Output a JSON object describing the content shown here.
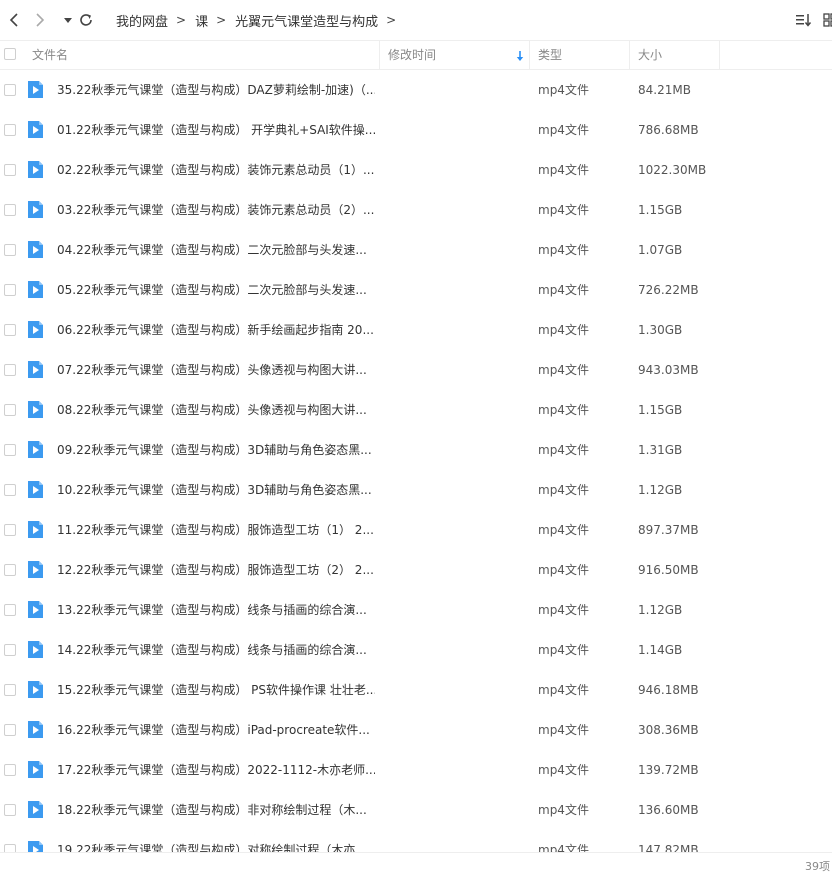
{
  "toolbar": {
    "back_icon": "chevron-left-icon",
    "forward_icon": "chevron-right-icon",
    "history_icon": "caret-down-icon",
    "refresh_icon": "refresh-icon",
    "sort_icon": "sort-list-icon",
    "view_icon": "grid-view-icon"
  },
  "breadcrumb": [
    "我的网盘",
    "课",
    "光翼元气课堂造型与构成"
  ],
  "breadcrumb_separator": ">",
  "columns": {
    "name": "文件名",
    "time": "修改时间",
    "type": "类型",
    "size": "大小"
  },
  "files": [
    {
      "name": "35.22秋季元气课堂（造型与构成）DAZ萝莉绘制-加速)（...",
      "type": "mp4文件",
      "size": "84.21MB"
    },
    {
      "name": "01.22秋季元气课堂（造型与构成） 开学典礼+SAI软件操...",
      "type": "mp4文件",
      "size": "786.68MB"
    },
    {
      "name": "02.22秋季元气课堂（造型与构成）装饰元素总动员（1）...",
      "type": "mp4文件",
      "size": "1022.30MB"
    },
    {
      "name": "03.22秋季元气课堂（造型与构成）装饰元素总动员（2）...",
      "type": "mp4文件",
      "size": "1.15GB"
    },
    {
      "name": "04.22秋季元气课堂（造型与构成）二次元脸部与头发速...",
      "type": "mp4文件",
      "size": "1.07GB"
    },
    {
      "name": "05.22秋季元气课堂（造型与构成）二次元脸部与头发速...",
      "type": "mp4文件",
      "size": "726.22MB"
    },
    {
      "name": "06.22秋季元气课堂（造型与构成）新手绘画起步指南 20...",
      "type": "mp4文件",
      "size": "1.30GB"
    },
    {
      "name": "07.22秋季元气课堂（造型与构成）头像透视与构图大讲...",
      "type": "mp4文件",
      "size": "943.03MB"
    },
    {
      "name": "08.22秋季元气课堂（造型与构成）头像透视与构图大讲...",
      "type": "mp4文件",
      "size": "1.15GB"
    },
    {
      "name": "09.22秋季元气课堂（造型与构成）3D辅助与角色姿态黑...",
      "type": "mp4文件",
      "size": "1.31GB"
    },
    {
      "name": "10.22秋季元气课堂（造型与构成）3D辅助与角色姿态黑...",
      "type": "mp4文件",
      "size": "1.12GB"
    },
    {
      "name": "11.22秋季元气课堂（造型与构成）服饰造型工坊（1） 2...",
      "type": "mp4文件",
      "size": "897.37MB"
    },
    {
      "name": "12.22秋季元气课堂（造型与构成）服饰造型工坊（2） 2...",
      "type": "mp4文件",
      "size": "916.50MB"
    },
    {
      "name": "13.22秋季元气课堂（造型与构成）线条与插画的综合演...",
      "type": "mp4文件",
      "size": "1.12GB"
    },
    {
      "name": "14.22秋季元气课堂（造型与构成）线条与插画的综合演...",
      "type": "mp4文件",
      "size": "1.14GB"
    },
    {
      "name": "15.22秋季元气课堂（造型与构成） PS软件操作课 壮壮老...",
      "type": "mp4文件",
      "size": "946.18MB"
    },
    {
      "name": "16.22秋季元气课堂（造型与构成）iPad-procreate软件...",
      "type": "mp4文件",
      "size": "308.36MB"
    },
    {
      "name": "17.22秋季元气课堂（造型与构成）2022-1112-木亦老师...",
      "type": "mp4文件",
      "size": "139.72MB"
    },
    {
      "name": "18.22秋季元气课堂（造型与构成）非对称绘制过程（木...",
      "type": "mp4文件",
      "size": "136.60MB"
    },
    {
      "name": "19.22秋季元气课堂（造型与构成）对称绘制过程（木亦...",
      "type": "mp4文件",
      "size": "147.82MB"
    }
  ],
  "footer": {
    "count": "39项"
  },
  "colors": {
    "accent": "#2b8ff5",
    "icon_blue": "#3c9af0"
  }
}
